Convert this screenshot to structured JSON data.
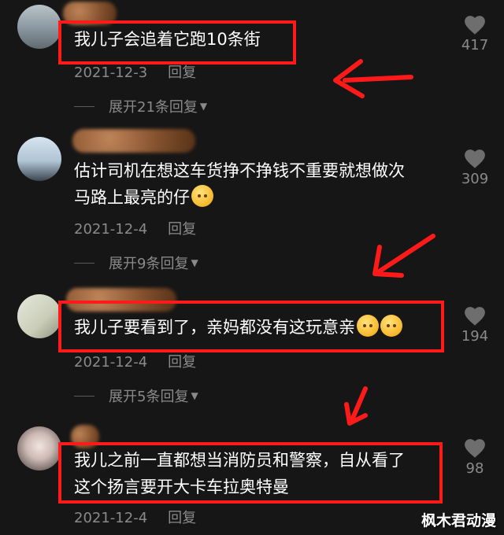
{
  "comments": [
    {
      "text_lines": [
        "我儿子会追着它跑10条街"
      ],
      "date": "2021-12-3",
      "reply_label": "回复",
      "expand_label": "展开21条回复",
      "likes": "417"
    },
    {
      "text_lines": [
        "估计司机在想这车货挣不挣钱不重要就想做次",
        "马路上最亮的仔"
      ],
      "date": "2021-12-4",
      "reply_label": "回复",
      "expand_label": "展开9条回复",
      "likes": "309"
    },
    {
      "text_lines": [
        "我儿子要看到了，亲妈都没有这玩意亲"
      ],
      "date": "2021-12-4",
      "reply_label": "回复",
      "expand_label": "展开5条回复",
      "likes": "194"
    },
    {
      "text_lines": [
        "我儿之前一直都想当消防员和警察，自从看了",
        "这个扬言要开大卡车拉奥特曼"
      ],
      "date": "2021-12-4",
      "reply_label": "回复",
      "likes": "98"
    }
  ],
  "watermark": "枫木君动漫",
  "colors": {
    "highlight_box": "#ff1a1a",
    "background": "#161616",
    "meta_text": "#8a8a8a"
  }
}
